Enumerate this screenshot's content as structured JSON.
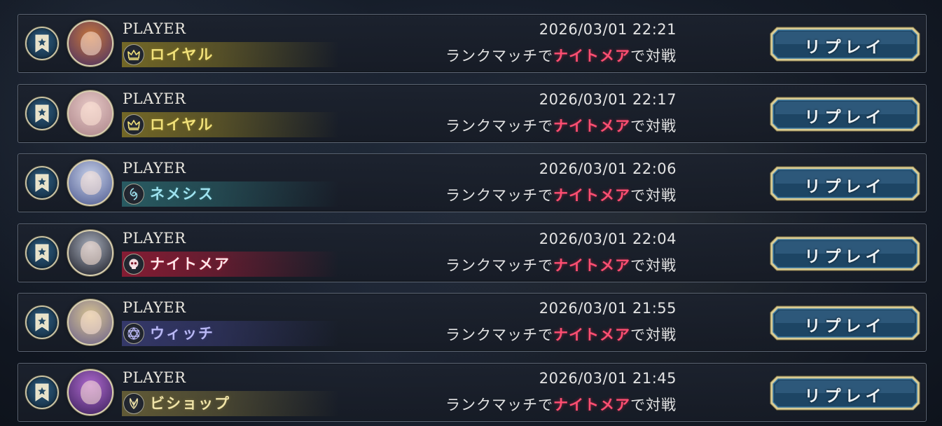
{
  "rows": [
    {
      "player": "PLAYER",
      "class_name": "ロイヤル",
      "class_icon": "crown-icon",
      "class_color": "#f2e27a",
      "band_color": "#8a7a26",
      "avatar_colors": [
        "#c9773b",
        "#5a3a5e"
      ],
      "datetime": "2026/03/01 22:21",
      "match_prefix": "ランクマッチで",
      "match_opponent": "ナイトメア",
      "match_suffix": "で対戦",
      "replay_label": "リプレイ"
    },
    {
      "player": "PLAYER",
      "class_name": "ロイヤル",
      "class_icon": "crown-icon",
      "class_color": "#f2e27a",
      "band_color": "#8a7a26",
      "avatar_colors": [
        "#e7c9c6",
        "#b48e92"
      ],
      "datetime": "2026/03/01 22:17",
      "match_prefix": "ランクマッチで",
      "match_opponent": "ナイトメア",
      "match_suffix": "で対戦",
      "replay_label": "リプレイ"
    },
    {
      "player": "PLAYER",
      "class_name": "ネメシス",
      "class_icon": "nemesis-icon",
      "class_color": "#9fe3f0",
      "band_color": "#2d6a70",
      "avatar_colors": [
        "#c8d2ea",
        "#5e6a9c"
      ],
      "datetime": "2026/03/01 22:06",
      "match_prefix": "ランクマッチで",
      "match_opponent": "ナイトメア",
      "match_suffix": "で対戦",
      "replay_label": "リプレイ"
    },
    {
      "player": "PLAYER",
      "class_name": "ナイトメア",
      "class_icon": "skull-icon",
      "class_color": "#ffe6ea",
      "band_color": "#a01c36",
      "avatar_colors": [
        "#a9b0bd",
        "#2d2f3a"
      ],
      "datetime": "2026/03/01 22:04",
      "match_prefix": "ランクマッチで",
      "match_opponent": "ナイトメア",
      "match_suffix": "で対戦",
      "replay_label": "リプレイ"
    },
    {
      "player": "PLAYER",
      "class_name": "ウィッチ",
      "class_icon": "hexagram-icon",
      "class_color": "#b9b8f4",
      "band_color": "#3c3f7a",
      "avatar_colors": [
        "#d9c592",
        "#7a6f8c"
      ],
      "datetime": "2026/03/01 21:55",
      "match_prefix": "ランクマッチで",
      "match_opponent": "ナイトメア",
      "match_suffix": "で対戦",
      "replay_label": "リプレイ"
    },
    {
      "player": "PLAYER",
      "class_name": "ビショップ",
      "class_icon": "wing-icon",
      "class_color": "#f0e4a8",
      "band_color": "#746a3a",
      "avatar_colors": [
        "#b06ad0",
        "#4a2a6a"
      ],
      "datetime": "2026/03/01 21:45",
      "match_prefix": "ランクマッチで",
      "match_opponent": "ナイトメア",
      "match_suffix": "で対戦",
      "replay_label": "リプレイ"
    }
  ]
}
